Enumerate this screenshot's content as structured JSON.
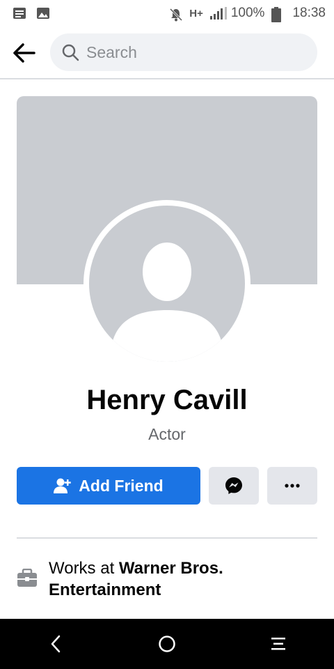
{
  "status_bar": {
    "left_icons": [
      "notes-icon",
      "image-icon"
    ],
    "network": "H+",
    "battery": "100%",
    "time": "18:38"
  },
  "search": {
    "placeholder": "Search",
    "value": ""
  },
  "profile": {
    "name": "Henry Cavill",
    "subtitle": "Actor"
  },
  "actions": {
    "add_friend_label": "Add Friend",
    "message_icon": "messenger-icon",
    "more_label": "···"
  },
  "intro": {
    "works_prefix": "Works at ",
    "works_company": "Warner Bros. Entertainment"
  },
  "colors": {
    "primary": "#1b74e4",
    "secondary_button": "#e4e6eb",
    "cover": "#c9ccd1",
    "text_secondary": "#65676b"
  }
}
